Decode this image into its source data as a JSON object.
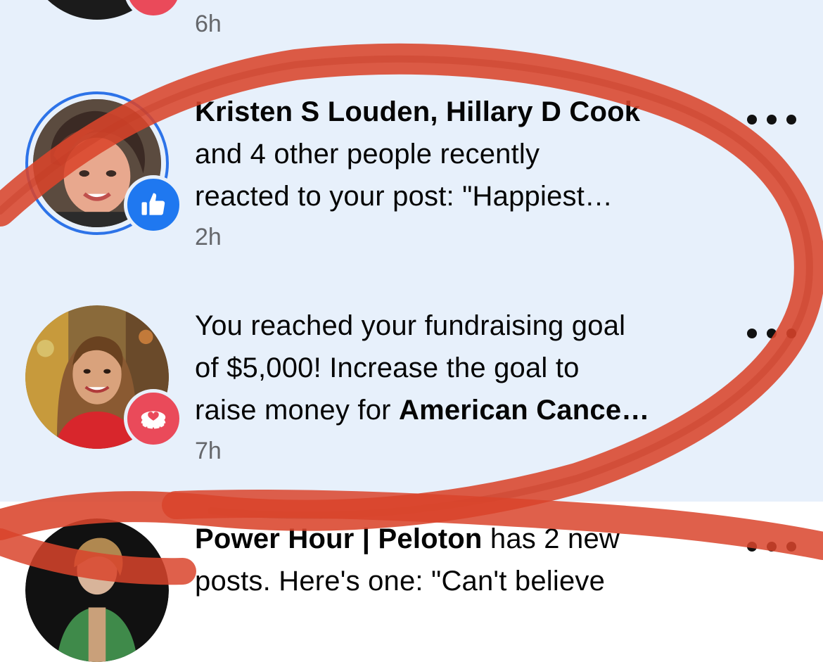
{
  "notifications": [
    {
      "time": "6h"
    },
    {
      "name1": "Kristen S Louden",
      "sep": ", ",
      "name2": "Hillary D Cook",
      "line1_rest": "and 4 other people recently",
      "line2": "reacted to your post: \"Happiest…",
      "time": "2h",
      "badge_icon": "thumbs-up-icon",
      "more_icon": "more-options-icon"
    },
    {
      "line0": "You reached your fundraising goal",
      "line1": "of $5,000! Increase the goal to",
      "line2_prefix": "raise money for ",
      "line2_bold": "American Cance…",
      "time": "7h",
      "badge_icon": "fundraiser-heart-icon",
      "more_icon": "more-options-icon"
    },
    {
      "bold": "Power Hour | Peloton",
      "rest": " has 2 new",
      "line1": "posts. Here's one: \"Can't believe",
      "more_icon": "more-options-icon"
    }
  ],
  "colors": {
    "unread_background": "#e7f0fb",
    "read_background": "#ffffff",
    "like_badge": "#1f78f0",
    "heart_badge": "#ea4a5a",
    "story_ring": "#2d73e8",
    "timestamp": "#65676b",
    "annotation_marker": "#d9442b"
  }
}
